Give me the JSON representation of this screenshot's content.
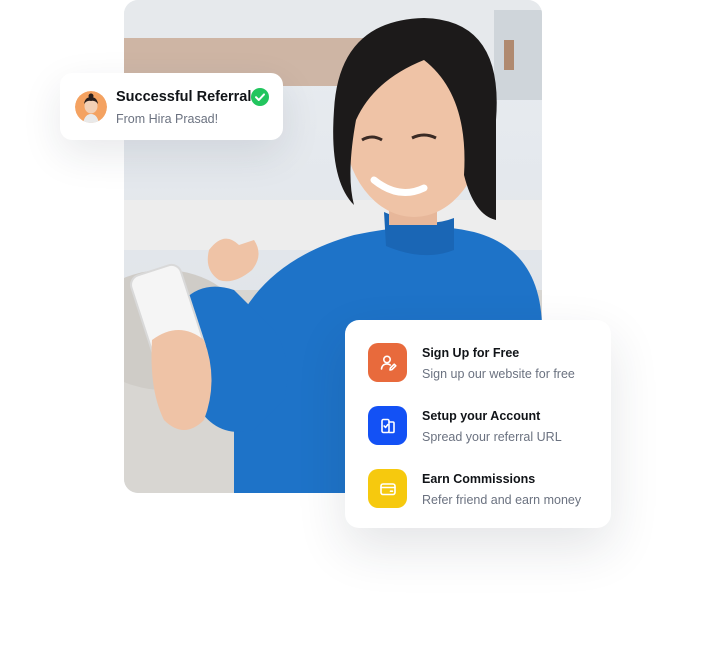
{
  "referral": {
    "title": "Successful Referral",
    "subtitle": "From Hira Prasad!",
    "check_color": "#22c55e",
    "avatar_bg": "#f4a261"
  },
  "steps": [
    {
      "title": "Sign Up for Free",
      "subtitle": "Sign up our website for free",
      "icon": "user-edit-icon",
      "color": "#e86a3c"
    },
    {
      "title": "Setup your Account",
      "subtitle": "Spread your referral URL",
      "icon": "clipboard-check-icon",
      "color": "#1351f5"
    },
    {
      "title": "Earn Commissions",
      "subtitle": "Refer friend and earn money",
      "icon": "wallet-icon",
      "color": "#f6c90e"
    }
  ]
}
